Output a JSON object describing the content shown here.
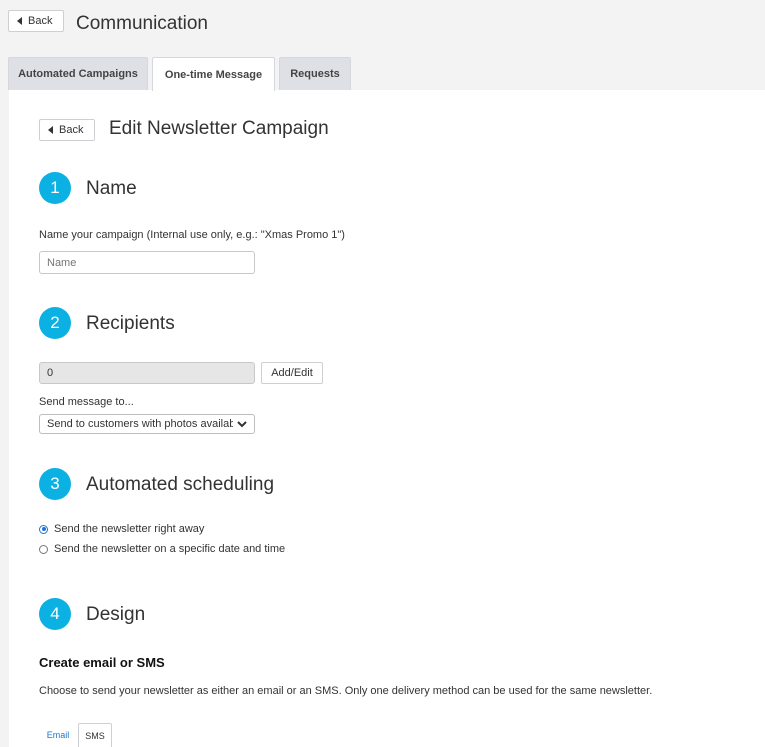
{
  "header": {
    "back_label": "Back",
    "title": "Communication"
  },
  "tabs": [
    {
      "label": "Automated Campaigns",
      "active": false
    },
    {
      "label": "One-time Message",
      "active": true
    },
    {
      "label": "Requests",
      "active": false
    }
  ],
  "edit": {
    "back_label": "Back",
    "title": "Edit Newsletter Campaign"
  },
  "steps": [
    {
      "number": "1",
      "title": "Name"
    },
    {
      "number": "2",
      "title": "Recipients"
    },
    {
      "number": "3",
      "title": "Automated scheduling"
    },
    {
      "number": "4",
      "title": "Design"
    }
  ],
  "name_section": {
    "label": "Name your campaign (Internal use only, e.g.: \"Xmas Promo 1\")",
    "placeholder": "Name",
    "value": ""
  },
  "recipients_section": {
    "count_value": "0",
    "add_edit_label": "Add/Edit",
    "send_to_label": "Send message to...",
    "send_to_selected": "Send to customers with photos available"
  },
  "scheduling_section": {
    "options": [
      {
        "label": "Send the newsletter right away",
        "checked": true
      },
      {
        "label": "Send the newsletter on a specific date and time",
        "checked": false
      }
    ]
  },
  "design_section": {
    "heading": "Create email or SMS",
    "description": "Choose to send your newsletter as either an email or an SMS. Only one delivery method can be used for the same newsletter.",
    "subtabs": [
      {
        "label": "Email",
        "active": true
      },
      {
        "label": "SMS",
        "active": false
      }
    ]
  },
  "colors": {
    "accent": "#0ab1e2",
    "link": "#1f74d6",
    "tab_bg": "#dfe0e6",
    "page_bg": "#f3f3f4"
  },
  "icons": {
    "back": "caret-left-icon",
    "select": "chevron-down-icon"
  }
}
